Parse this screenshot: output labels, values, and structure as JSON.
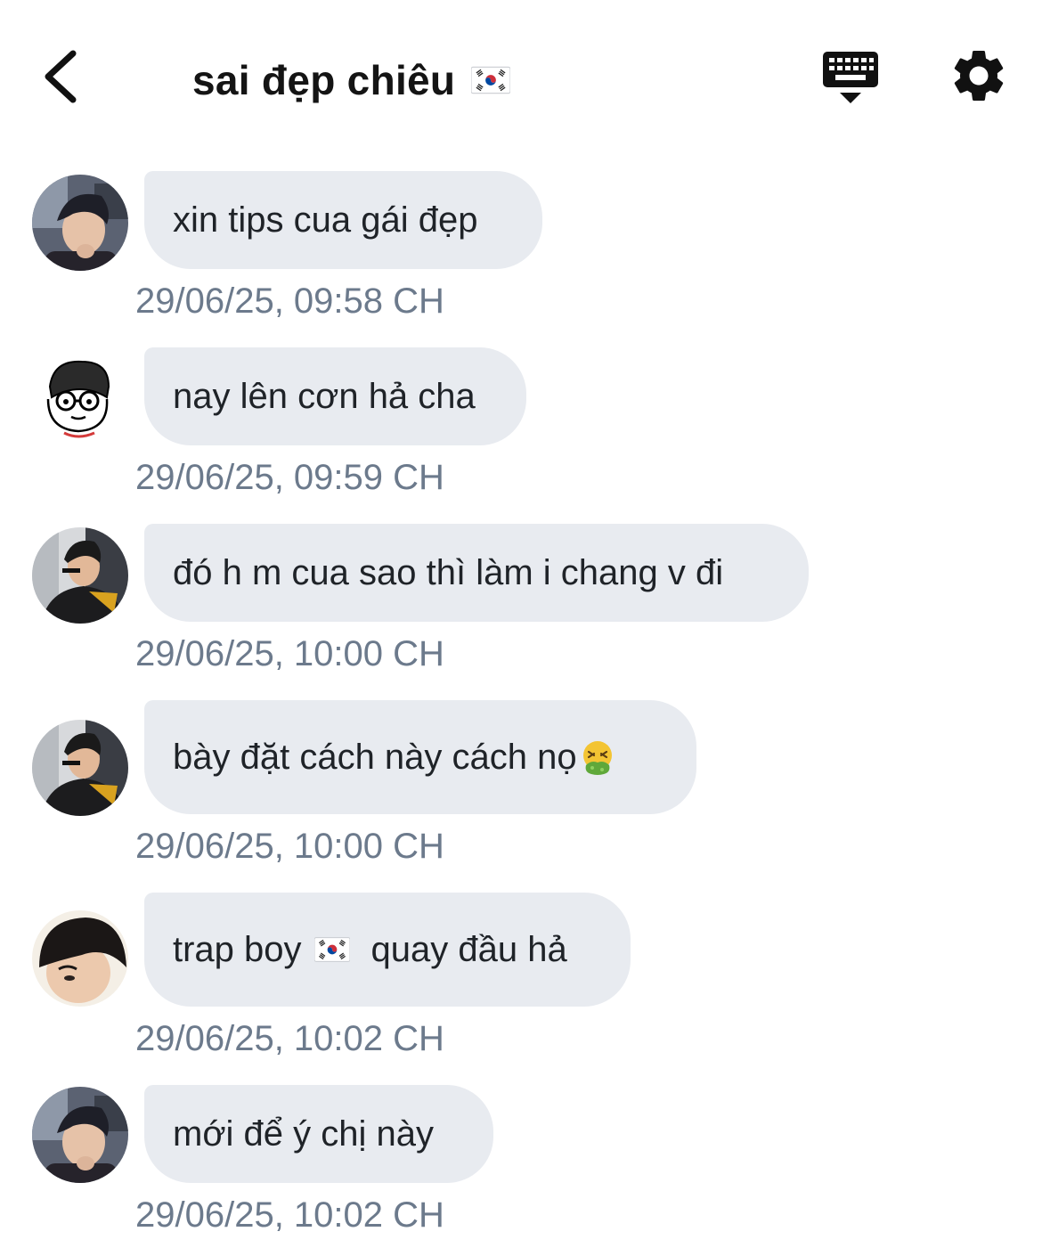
{
  "header": {
    "back_icon": "chevron-left-icon",
    "title": "sai đẹp chiêu",
    "title_flag_icon": "south-korea-flag-icon",
    "keyboard_icon": "keyboard-icon",
    "settings_icon": "gear-icon"
  },
  "colors": {
    "bubble_bg": "#e8ebf0",
    "timestamp": "#6c7a8c",
    "text": "#1f2328"
  },
  "messages": [
    {
      "text": "xin tips cua gái đẹp",
      "time": "29/06/25, 09:58 CH"
    },
    {
      "text": "nay lên cơn hả cha",
      "time": "29/06/25, 09:59 CH"
    },
    {
      "text": "đó h m cua sao thì làm i chang v đi",
      "time": "29/06/25, 10:00 CH"
    },
    {
      "text": "bày đặt cách này cách nọ",
      "emoji": "🤮",
      "time": "29/06/25, 10:00 CH"
    },
    {
      "text_before": "trap boy",
      "flag_icon": "south-korea-flag-icon",
      "text_after": "quay đầu hả",
      "time": "29/06/25, 10:02 CH"
    },
    {
      "text": "mới để ý chị này",
      "time": "29/06/25, 10:02 CH"
    }
  ]
}
